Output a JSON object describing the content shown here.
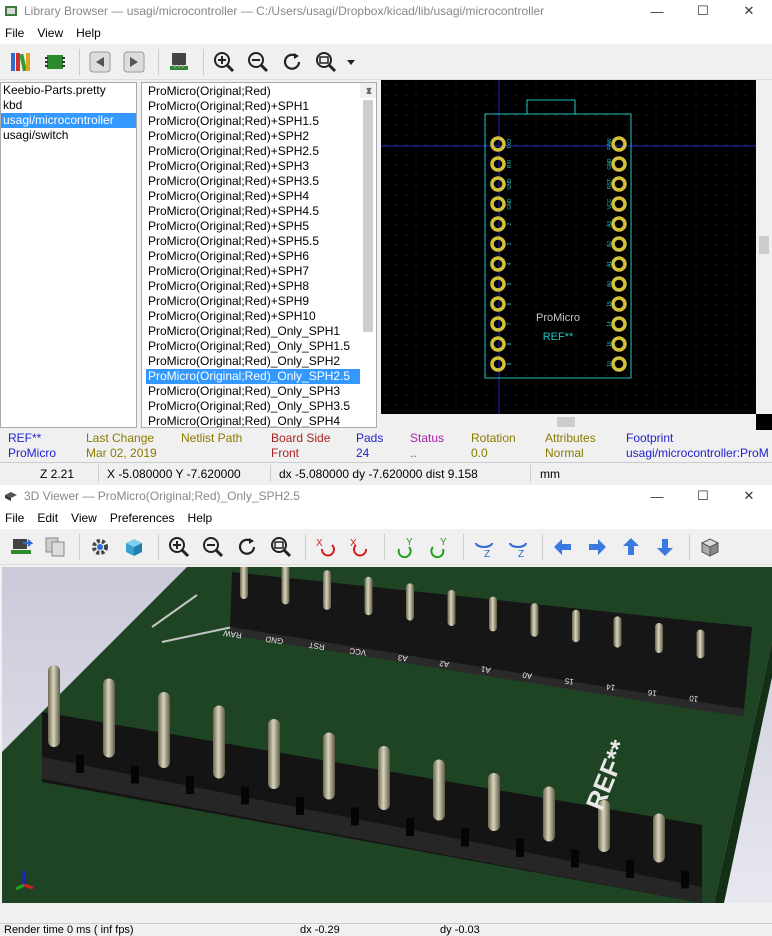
{
  "library_browser": {
    "title": "Library Browser — usagi/microcontroller — C:/Users/usagi/Dropbox/kicad/lib/usagi/microcontroller",
    "menu": [
      "File",
      "View",
      "Help"
    ],
    "libraries": [
      "Keebio-Parts.pretty",
      "kbd",
      "usagi/microcontroller",
      "usagi/switch"
    ],
    "selected_library": 2,
    "footprints": [
      "ProMicro(Original;Red)",
      "ProMicro(Original;Red)+SPH1",
      "ProMicro(Original;Red)+SPH1.5",
      "ProMicro(Original;Red)+SPH2",
      "ProMicro(Original;Red)+SPH2.5",
      "ProMicro(Original;Red)+SPH3",
      "ProMicro(Original;Red)+SPH3.5",
      "ProMicro(Original;Red)+SPH4",
      "ProMicro(Original;Red)+SPH4.5",
      "ProMicro(Original;Red)+SPH5",
      "ProMicro(Original;Red)+SPH5.5",
      "ProMicro(Original;Red)+SPH6",
      "ProMicro(Original;Red)+SPH7",
      "ProMicro(Original;Red)+SPH8",
      "ProMicro(Original;Red)+SPH9",
      "ProMicro(Original;Red)+SPH10",
      "ProMicro(Original;Red)_Only_SPH1",
      "ProMicro(Original;Red)_Only_SPH1.5",
      "ProMicro(Original;Red)_Only_SPH2",
      "ProMicro(Original;Red)_Only_SPH2.5",
      "ProMicro(Original;Red)_Only_SPH3",
      "ProMicro(Original;Red)_Only_SPH3.5",
      "ProMicro(Original;Red)_Only_SPH4"
    ],
    "selected_footprint": 19,
    "canvas": {
      "value_text": "ProMicro",
      "ref_text": "REF**",
      "left_pin_labels": [
        "TXO",
        "RXI",
        "GND",
        "GND",
        "2",
        "3",
        "4",
        "5",
        "6",
        "7",
        "8",
        "9"
      ],
      "right_pin_labels": [
        "RAW",
        "GND",
        "RST",
        "VCC",
        "A3",
        "A2",
        "A1",
        "A0",
        "15",
        "14",
        "16",
        "10"
      ]
    },
    "msgpanel": {
      "ref_value": "REF**",
      "ref_name": "ProMicro",
      "last_change_label": "Last Change",
      "last_change_value": "Mar 02, 2019",
      "netlist_path_label": "Netlist Path",
      "netlist_path_value": "",
      "board_side_label": "Board Side",
      "board_side_value": "Front",
      "pads_label": "Pads",
      "pads_value": "24",
      "status_label": "Status",
      "status_value": "..",
      "rotation_label": "Rotation",
      "rotation_value": "0.0",
      "attributes_label": "Attributes",
      "attributes_value": "Normal",
      "footprint_label": "Footprint",
      "footprint_value": "usagi/microcontroller:ProM"
    },
    "status": {
      "zoom": "Z 2.21",
      "xy": "X -5.080000  Y -7.620000",
      "dxdy": "dx -5.080000  dy -7.620000  dist 9.158",
      "units": "mm"
    }
  },
  "viewer_3d": {
    "title": "3D Viewer — ProMicro(Original;Red)_Only_SPH2.5",
    "menu": [
      "File",
      "Edit",
      "View",
      "Preferences",
      "Help"
    ],
    "silk_labels": [
      "RAW",
      "GND",
      "RST",
      "VCC",
      "A3",
      "A2",
      "A1",
      "A0",
      "15",
      "14",
      "16",
      "10"
    ],
    "ref_text": "REF**",
    "status": {
      "render_time": "Render time 0 ms ( inf fps)",
      "dx": "dx -0.29",
      "dy": "dy -0.03"
    }
  },
  "colors": {
    "selection": "#3399ff",
    "courtyard": "#26c4c4",
    "silk": "#c4c4c4",
    "pad": "#d4c23a",
    "pcb": "#1e4424"
  }
}
